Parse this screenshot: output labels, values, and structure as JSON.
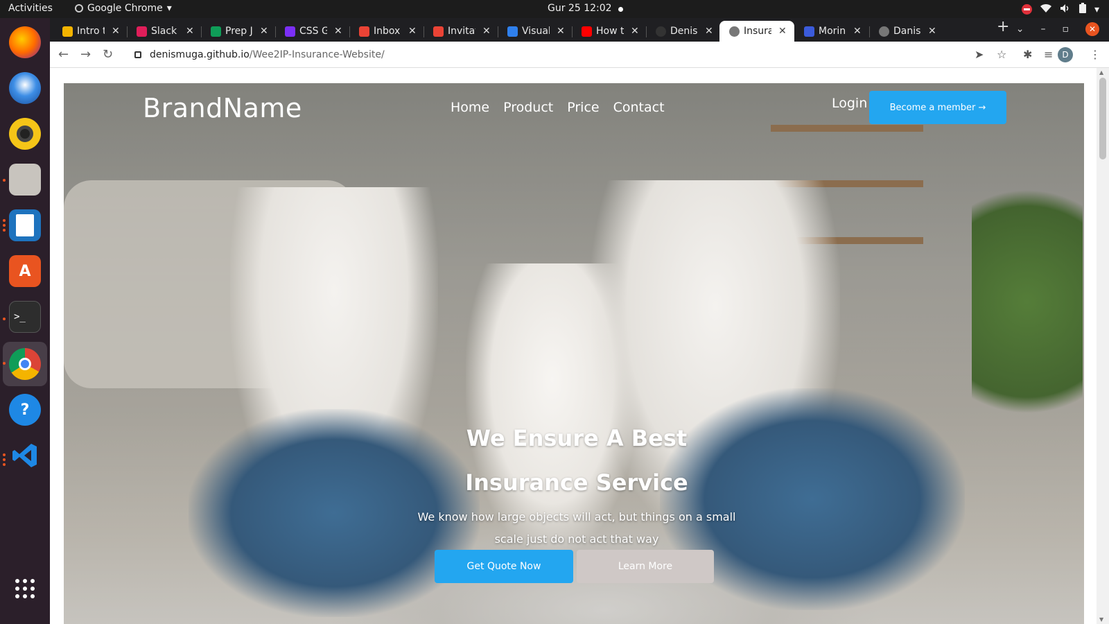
{
  "system": {
    "activities": "Activities",
    "app_name": "Google Chrome",
    "clock": "Gur 25  12:02"
  },
  "dock": {
    "apps": [
      "firefox-icon",
      "thunderbird-icon",
      "rhythmbox-icon",
      "files-icon",
      "writer-icon",
      "software-icon",
      "terminal-icon",
      "chrome-icon",
      "help-icon",
      "vscode-icon",
      "app-grid-icon"
    ]
  },
  "browser": {
    "tabs": [
      {
        "title": "Intro t",
        "color": "#f4b400"
      },
      {
        "title": "Slack |",
        "color": "#e01e5a"
      },
      {
        "title": "Prep J",
        "color": "#0f9d58"
      },
      {
        "title": "CSS Gr",
        "color": "#7b2ff7"
      },
      {
        "title": "Inbox",
        "color": "#ea4335"
      },
      {
        "title": "Invitat",
        "color": "#ea4335"
      },
      {
        "title": "Visual",
        "color": "#2f80ed"
      },
      {
        "title": "How t",
        "color": "#ff0000"
      },
      {
        "title": "Denis",
        "color": "#333333"
      },
      {
        "title": "Insura",
        "color": "#777777"
      },
      {
        "title": "Morin",
        "color": "#3b5bdb"
      },
      {
        "title": "Danis",
        "color": "#777777"
      }
    ],
    "active_tab_index": 9,
    "url_host": "denismuga.github.io",
    "url_path": "/Wee2IP-Insurance-Website/",
    "avatar_letter": "D"
  },
  "page": {
    "brand": "BrandName",
    "nav": [
      "Home",
      "Product",
      "Price",
      "Contact"
    ],
    "login": "Login",
    "member_button": "Become a member →",
    "headline_line1": "We Ensure A Best",
    "headline_line2": "Insurance Service",
    "subline": "We know how large objects will act, but things on a small scale just do not act that way",
    "quote_button": "Get Quote Now",
    "learn_button": "Learn More",
    "accent_color": "#23a6f0"
  }
}
